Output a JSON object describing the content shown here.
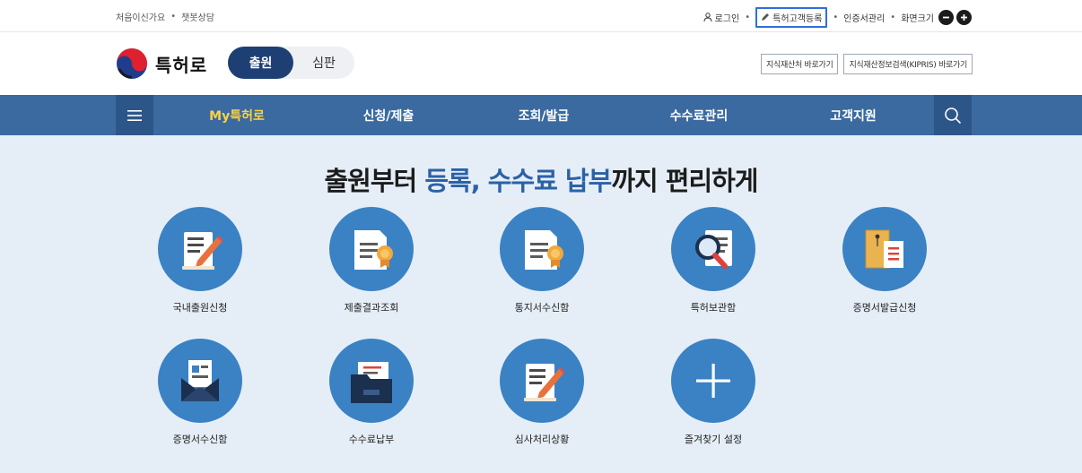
{
  "util": {
    "left": [
      "처음이신가요",
      "챗봇상담"
    ],
    "right": [
      "로그인",
      "특허고객등록",
      "인증서관리",
      "화면크기"
    ]
  },
  "header": {
    "logo_text": "특허로",
    "toggle": {
      "on": "출원",
      "off": "심판"
    },
    "ext_links": [
      "지식재산처 바로가기",
      "지식재산정보검색(KIPRIS) 바로가기"
    ]
  },
  "nav": {
    "items": [
      "My특허로",
      "신청/제출",
      "조회/발급",
      "수수료관리",
      "고객지원"
    ]
  },
  "headline": {
    "part1": "출원",
    "part2": "부터 ",
    "part3": "등록, 수수료 납부",
    "part4": "까지 편리하게"
  },
  "tiles": [
    {
      "label": "국내출원신청",
      "icon": "document-pen-icon"
    },
    {
      "label": "제출결과조회",
      "icon": "document-certificate-icon"
    },
    {
      "label": "통지서수신함",
      "icon": "document-certificate-icon"
    },
    {
      "label": "특허보관함",
      "icon": "document-search-icon"
    },
    {
      "label": "증명서발급신청",
      "icon": "envelope-document-icon"
    },
    {
      "label": "증명서수신함",
      "icon": "open-mail-icon"
    },
    {
      "label": "수수료납부",
      "icon": "folder-icon"
    },
    {
      "label": "심사처리상황",
      "icon": "document-pen-icon"
    },
    {
      "label": "즐겨찾기 설정",
      "icon": "plus-icon"
    }
  ],
  "colors": {
    "nav_bg": "#3a6aa0",
    "nav_active": "#ffd23f",
    "toggle_on": "#1e3f73",
    "tile_circle": "#3a82c4",
    "main_bg": "#e5eef7",
    "accent_text": "#2b62a6"
  }
}
